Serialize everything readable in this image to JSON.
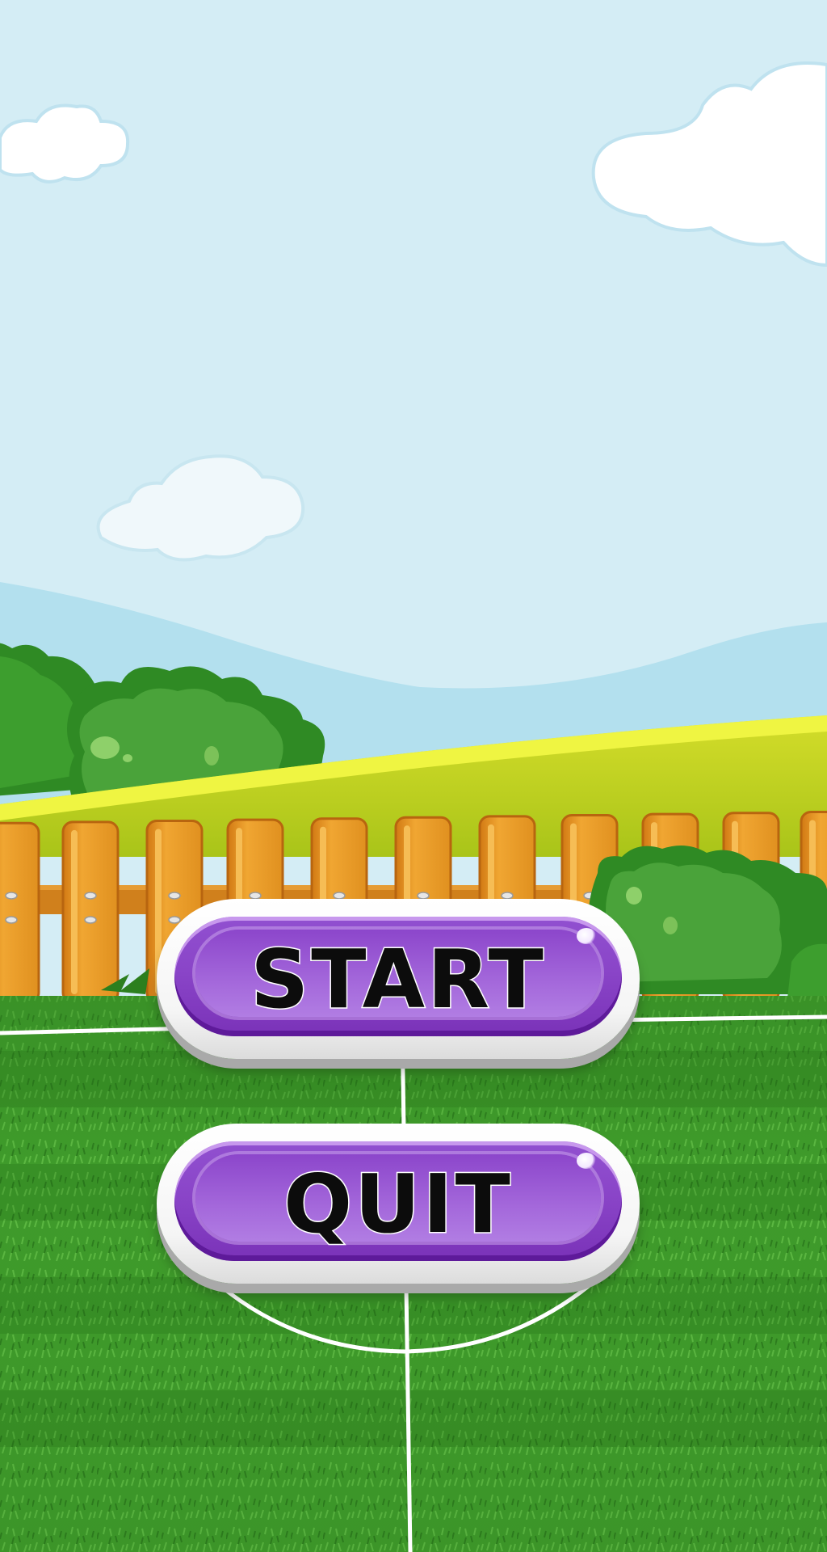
{
  "menu": {
    "start_label": "START",
    "quit_label": "QUIT"
  },
  "scene": {
    "sky_color": "#d4edf5",
    "hill_color": "#b3e0ee",
    "meadow_color": "#d7e12c",
    "fence_color": "#e99a2a",
    "bush_color": "#2f8a24",
    "grass_color": "#3d9a2a",
    "field_line_color": "#ffffff",
    "button_color": "#8a45c8"
  }
}
